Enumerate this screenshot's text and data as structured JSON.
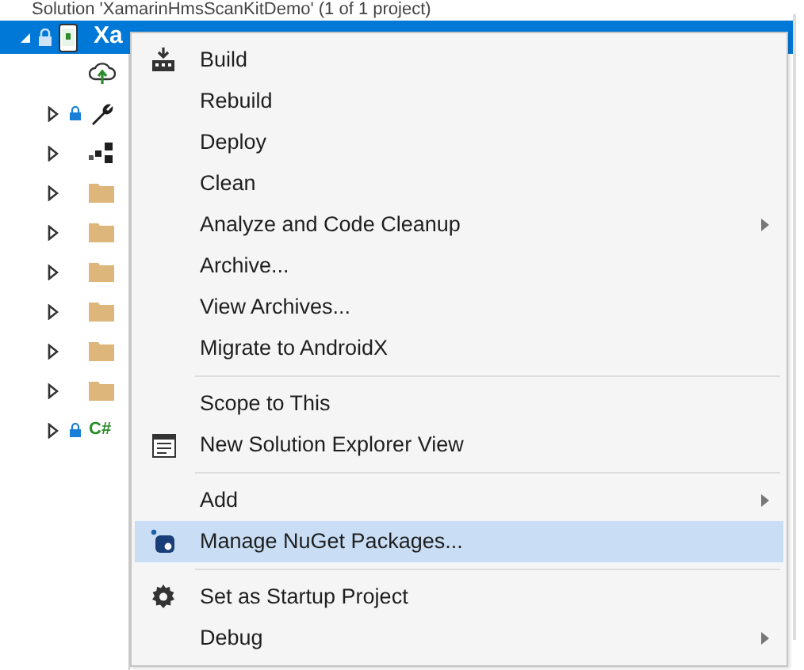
{
  "solution_header": {
    "text": "Solution 'XamarinHmsScanKitDemo' (1 of 1 project)"
  },
  "project": {
    "label": "Xa",
    "selected": true,
    "expanded": true
  },
  "tree": [
    {
      "kind": "cloud"
    },
    {
      "kind": "wrench",
      "expanded": false,
      "locked": true
    },
    {
      "kind": "references",
      "expanded": false,
      "locked": false
    },
    {
      "kind": "folder",
      "expanded": false,
      "locked": false
    },
    {
      "kind": "folder",
      "expanded": false,
      "locked": false
    },
    {
      "kind": "folder",
      "expanded": false,
      "locked": false
    },
    {
      "kind": "folder",
      "expanded": false,
      "locked": false
    },
    {
      "kind": "folder",
      "expanded": false,
      "locked": false
    },
    {
      "kind": "folder",
      "expanded": false,
      "locked": false
    },
    {
      "kind": "csharp",
      "expanded": false,
      "locked": true,
      "label": "C#"
    }
  ],
  "context_menu": [
    {
      "kind": "build",
      "label": "Build",
      "submenu": false,
      "selected": false
    },
    {
      "kind": "item",
      "label": "Rebuild",
      "submenu": false,
      "selected": false
    },
    {
      "kind": "item",
      "label": "Deploy",
      "submenu": false,
      "selected": false
    },
    {
      "kind": "item",
      "label": "Clean",
      "submenu": false,
      "selected": false
    },
    {
      "kind": "item",
      "label": "Analyze and Code Cleanup",
      "submenu": true,
      "selected": false
    },
    {
      "kind": "item",
      "label": "Archive...",
      "submenu": false,
      "selected": false
    },
    {
      "kind": "item",
      "label": "View Archives...",
      "submenu": false,
      "selected": false
    },
    {
      "kind": "item",
      "label": "Migrate to AndroidX",
      "submenu": false,
      "selected": false
    },
    {
      "kind": "separator"
    },
    {
      "kind": "item",
      "label": "Scope to This",
      "submenu": false,
      "selected": false
    },
    {
      "kind": "window",
      "label": "New Solution Explorer View",
      "submenu": false,
      "selected": false
    },
    {
      "kind": "separator"
    },
    {
      "kind": "item",
      "label": "Add",
      "submenu": true,
      "selected": false
    },
    {
      "kind": "nuget",
      "label": "Manage NuGet Packages...",
      "submenu": false,
      "selected": true
    },
    {
      "kind": "separator"
    },
    {
      "kind": "gear",
      "label": "Set as Startup Project",
      "submenu": false,
      "selected": false
    },
    {
      "kind": "item",
      "label": "Debug",
      "submenu": true,
      "selected": false
    }
  ]
}
